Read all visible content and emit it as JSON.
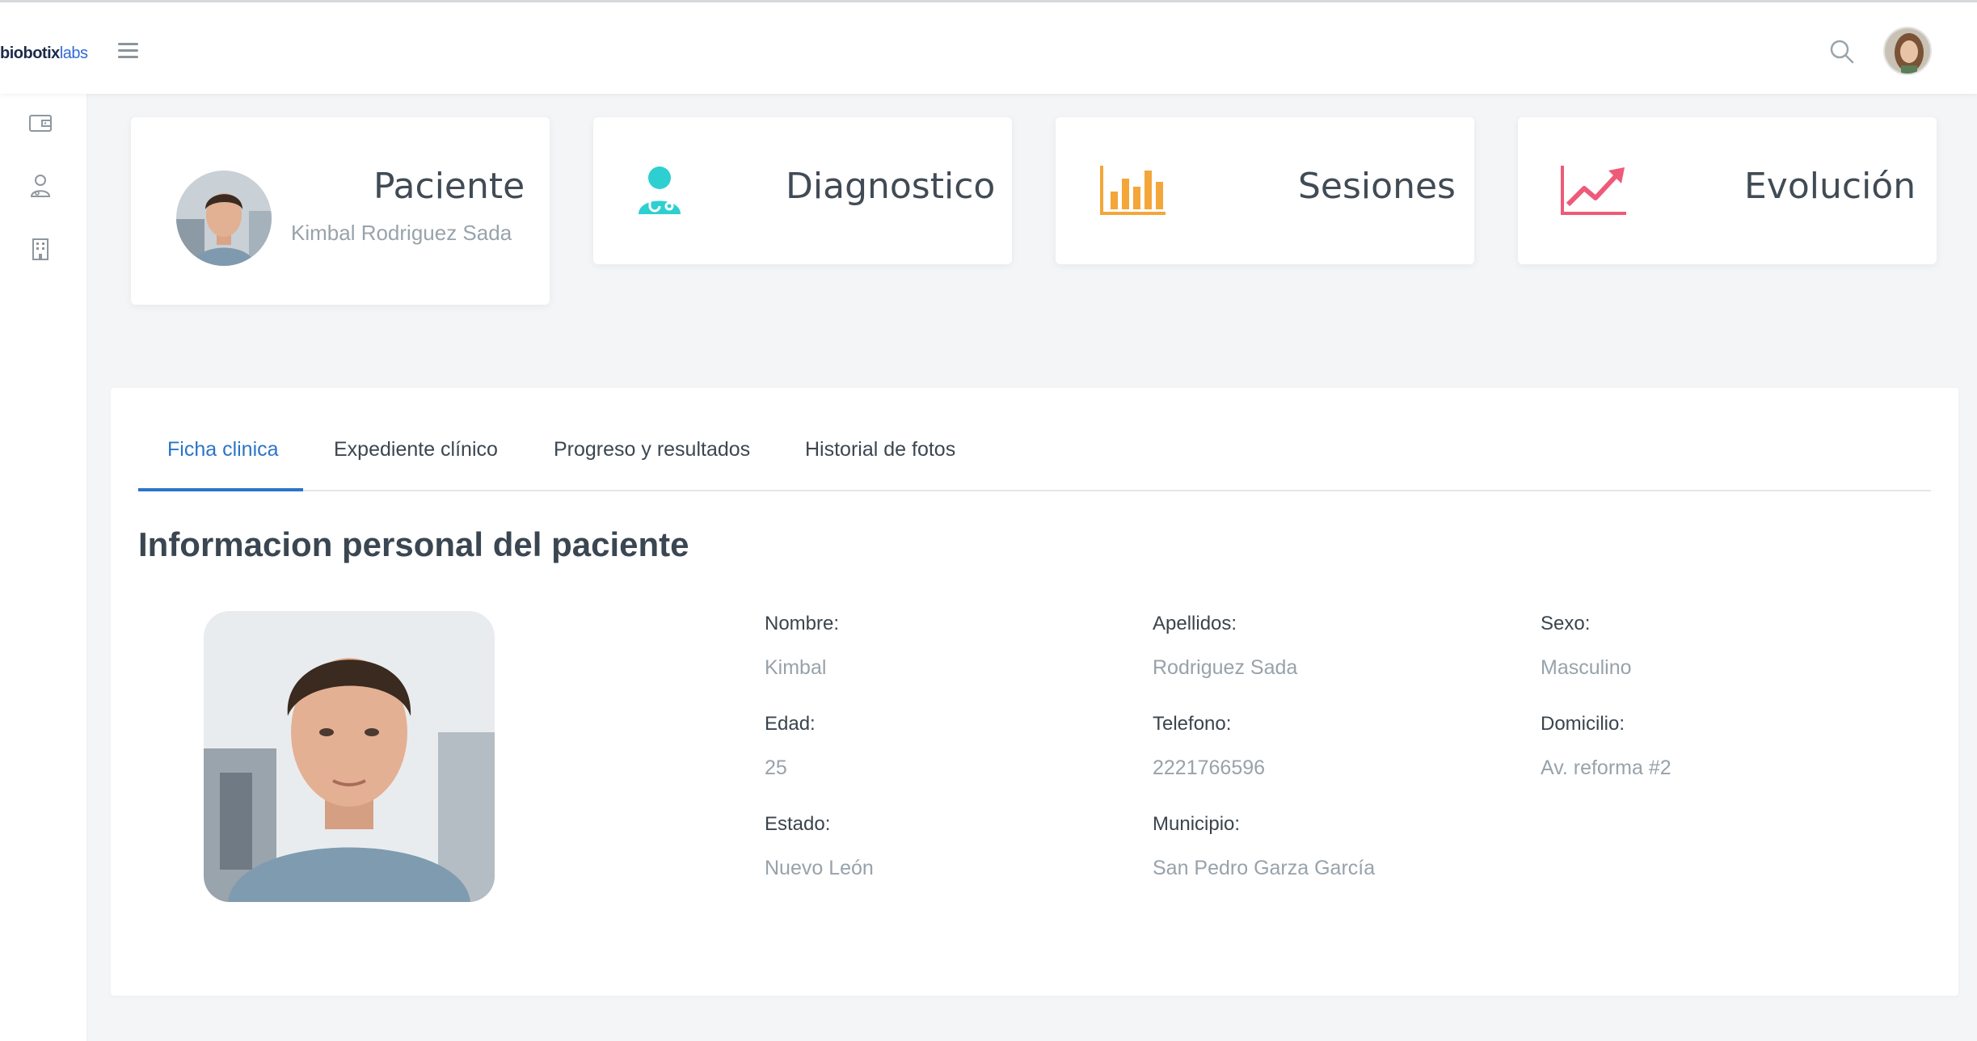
{
  "brand": {
    "name": "biobotix",
    "suffix": "labs"
  },
  "header": {
    "menu_icon": "hamburger-icon",
    "search_icon": "search-icon",
    "user_avatar": "user-avatar"
  },
  "sidebar": {
    "items": [
      {
        "icon": "wallet-icon"
      },
      {
        "icon": "doctor-icon"
      },
      {
        "icon": "building-icon"
      }
    ]
  },
  "cards": {
    "patient": {
      "title": "Paciente",
      "name": "Kimbal Rodriguez Sada"
    },
    "diagnosis": {
      "title": "Diagnostico",
      "icon": "doctor-stethoscope-icon",
      "color": "#2ecfd1"
    },
    "sessions": {
      "title": "Sesiones",
      "icon": "bar-chart-icon",
      "color": "#f4a63a"
    },
    "evolution": {
      "title": "Evolución",
      "icon": "trend-up-icon",
      "color": "#ef5a7a"
    }
  },
  "tabs": [
    {
      "label": "Ficha clinica",
      "active": true
    },
    {
      "label": "Expediente clínico",
      "active": false
    },
    {
      "label": "Progreso y resultados",
      "active": false
    },
    {
      "label": "Historial de fotos",
      "active": false
    }
  ],
  "section": {
    "title": "Informacion personal del paciente"
  },
  "fields": {
    "nombre": {
      "label": "Nombre:",
      "value": "Kimbal"
    },
    "apellidos": {
      "label": "Apellidos:",
      "value": "Rodriguez Sada"
    },
    "sexo": {
      "label": "Sexo:",
      "value": "Masculino"
    },
    "edad": {
      "label": "Edad:",
      "value": "25"
    },
    "telefono": {
      "label": "Telefono:",
      "value": "2221766596"
    },
    "domicilio": {
      "label": "Domicilio:",
      "value": "Av. reforma #2"
    },
    "estado": {
      "label": "Estado:",
      "value": "Nuevo León"
    },
    "municipio": {
      "label": "Municipio:",
      "value": "San Pedro Garza García"
    }
  },
  "colors": {
    "accent": "#2b74c8"
  }
}
